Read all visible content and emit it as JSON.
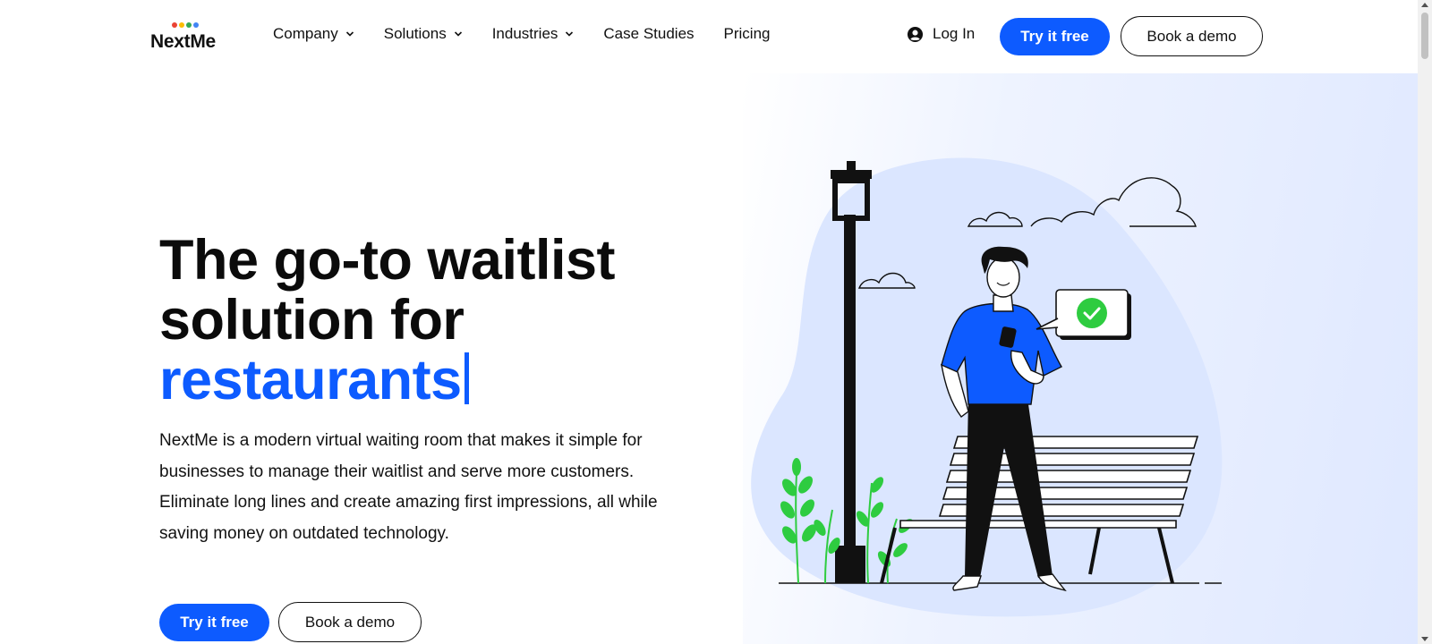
{
  "brand": {
    "name": "NextMe",
    "dot_colors": [
      "#ea4335",
      "#fbbc05",
      "#34a853",
      "#4285f4"
    ]
  },
  "nav": {
    "items": [
      {
        "label": "Company",
        "dropdown": true
      },
      {
        "label": "Solutions",
        "dropdown": true
      },
      {
        "label": "Industries",
        "dropdown": true
      },
      {
        "label": "Case Studies",
        "dropdown": false
      },
      {
        "label": "Pricing",
        "dropdown": false
      }
    ],
    "login_label": "Log In",
    "try_free_label": "Try it free",
    "book_demo_label": "Book a demo"
  },
  "hero": {
    "headline_line1": "The go-to waitlist",
    "headline_line2": "solution for",
    "headline_accent": "restaurants",
    "description": "NextMe is a modern virtual waiting room that makes it simple for businesses to manage their waitlist and serve more customers. Eliminate long lines and create amazing first impressions, all while saving money on outdated technology.",
    "try_free_label": "Try it free",
    "book_demo_label": "Book a demo"
  },
  "colors": {
    "accent": "#0d5bff",
    "text": "#111111",
    "blob": "#dbe6ff",
    "leaf": "#2ecc40"
  },
  "icons": [
    "chevron-down-icon",
    "user-circle-icon",
    "check-icon"
  ]
}
